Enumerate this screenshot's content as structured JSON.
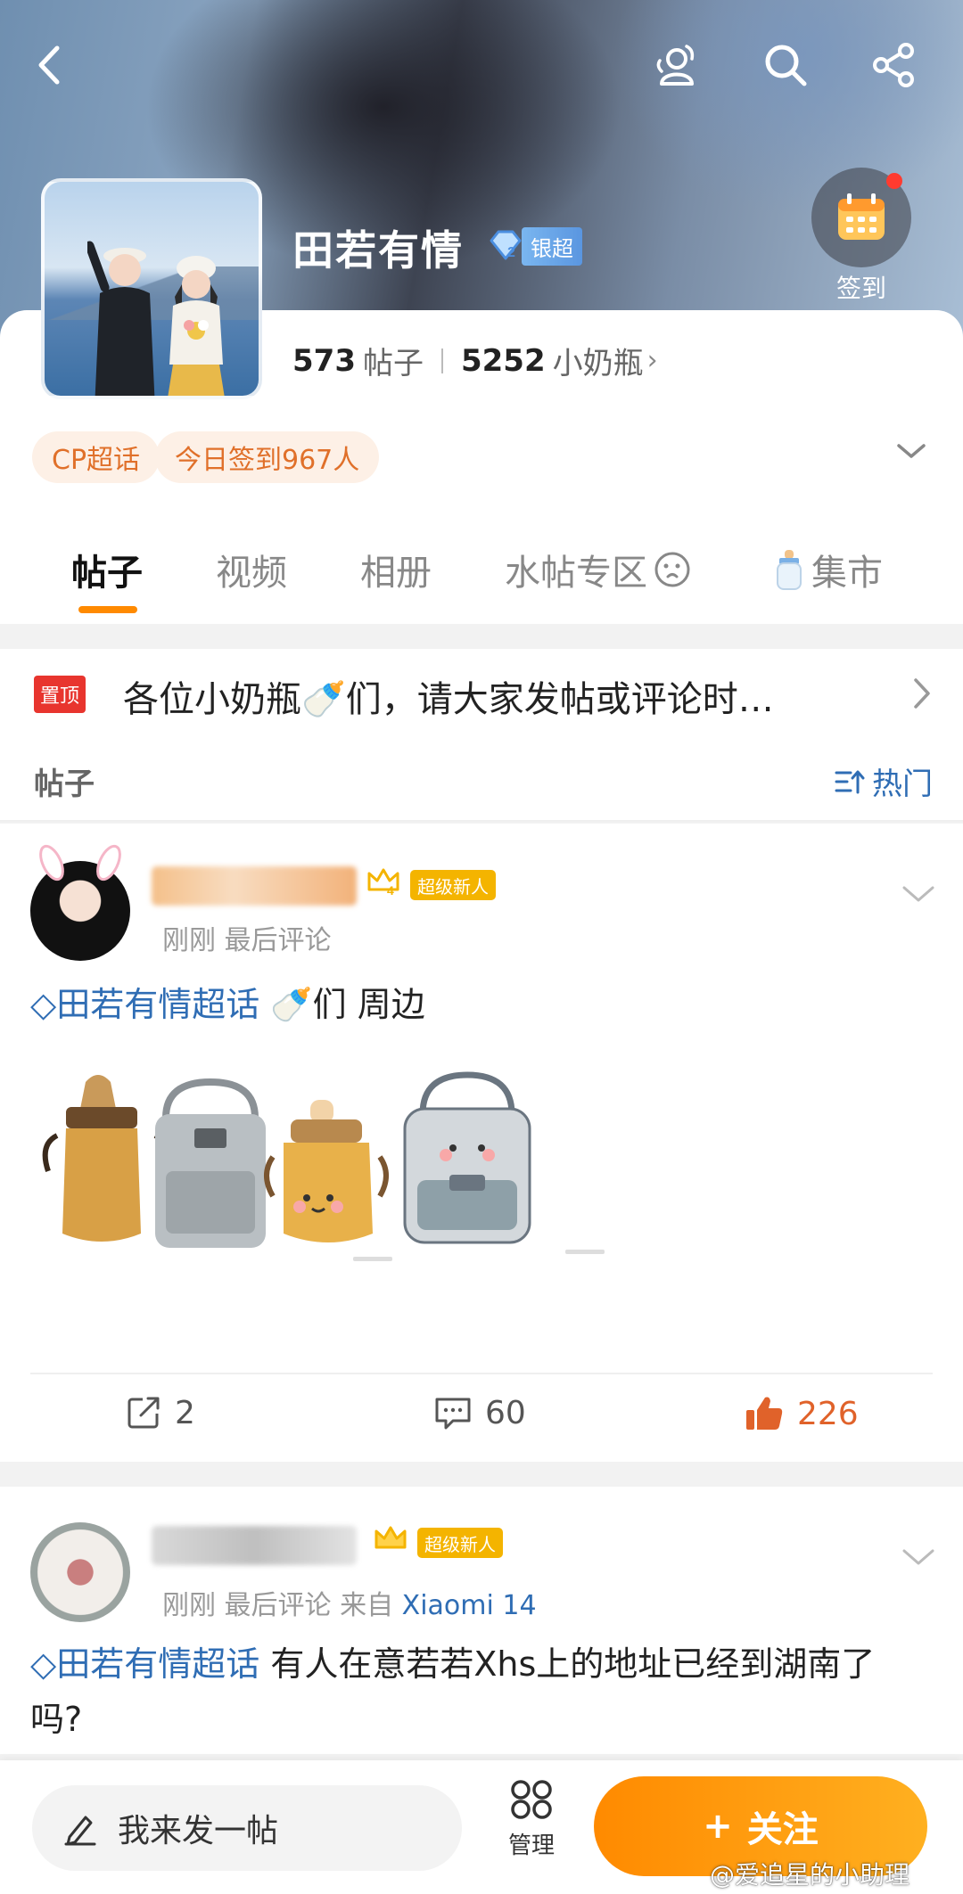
{
  "header": {
    "title": "田若有情",
    "badge_label": "银超",
    "signin_label": "签到"
  },
  "stats": {
    "posts_count": "573",
    "posts_label": "帖子",
    "fans_count": "5252",
    "fans_label": "小奶瓶"
  },
  "pills": [
    "CP超话",
    "今日签到967人"
  ],
  "tabs": [
    "帖子",
    "视频",
    "相册",
    "水帖专区",
    "集市"
  ],
  "pinned": {
    "tag": "置顶",
    "text": "各位小奶瓶🍼们，请大家发帖或评论时…"
  },
  "feed": {
    "section_label": "帖子",
    "sort_label": "热门"
  },
  "posts": [
    {
      "vip_label": "超级新人",
      "crown_level": "4",
      "meta_time": "刚刚 最后评论",
      "meta_source_prefix": "",
      "meta_device": "",
      "topic": "田若有情超话",
      "text": "🍼们 周边",
      "reposts": "2",
      "comments": "60",
      "likes": "226"
    },
    {
      "vip_label": "超级新人",
      "crown_level": "",
      "meta_time": "刚刚 最后评论",
      "meta_source_prefix": "来自",
      "meta_device": "Xiaomi 14",
      "topic": "田若有情超话",
      "text": "有人在意若若Xhs上的地址已经到湖南了吗?"
    }
  ],
  "bottom": {
    "compose_placeholder": "我来发一帖",
    "manage_label": "管理",
    "follow_label": "关注"
  },
  "watermark": "@爱追星的小助理",
  "colors": {
    "accent_orange": "#ff8a00",
    "link_blue": "#2f6db4",
    "like_orange": "#e0622a",
    "pin_red": "#e8352e"
  }
}
